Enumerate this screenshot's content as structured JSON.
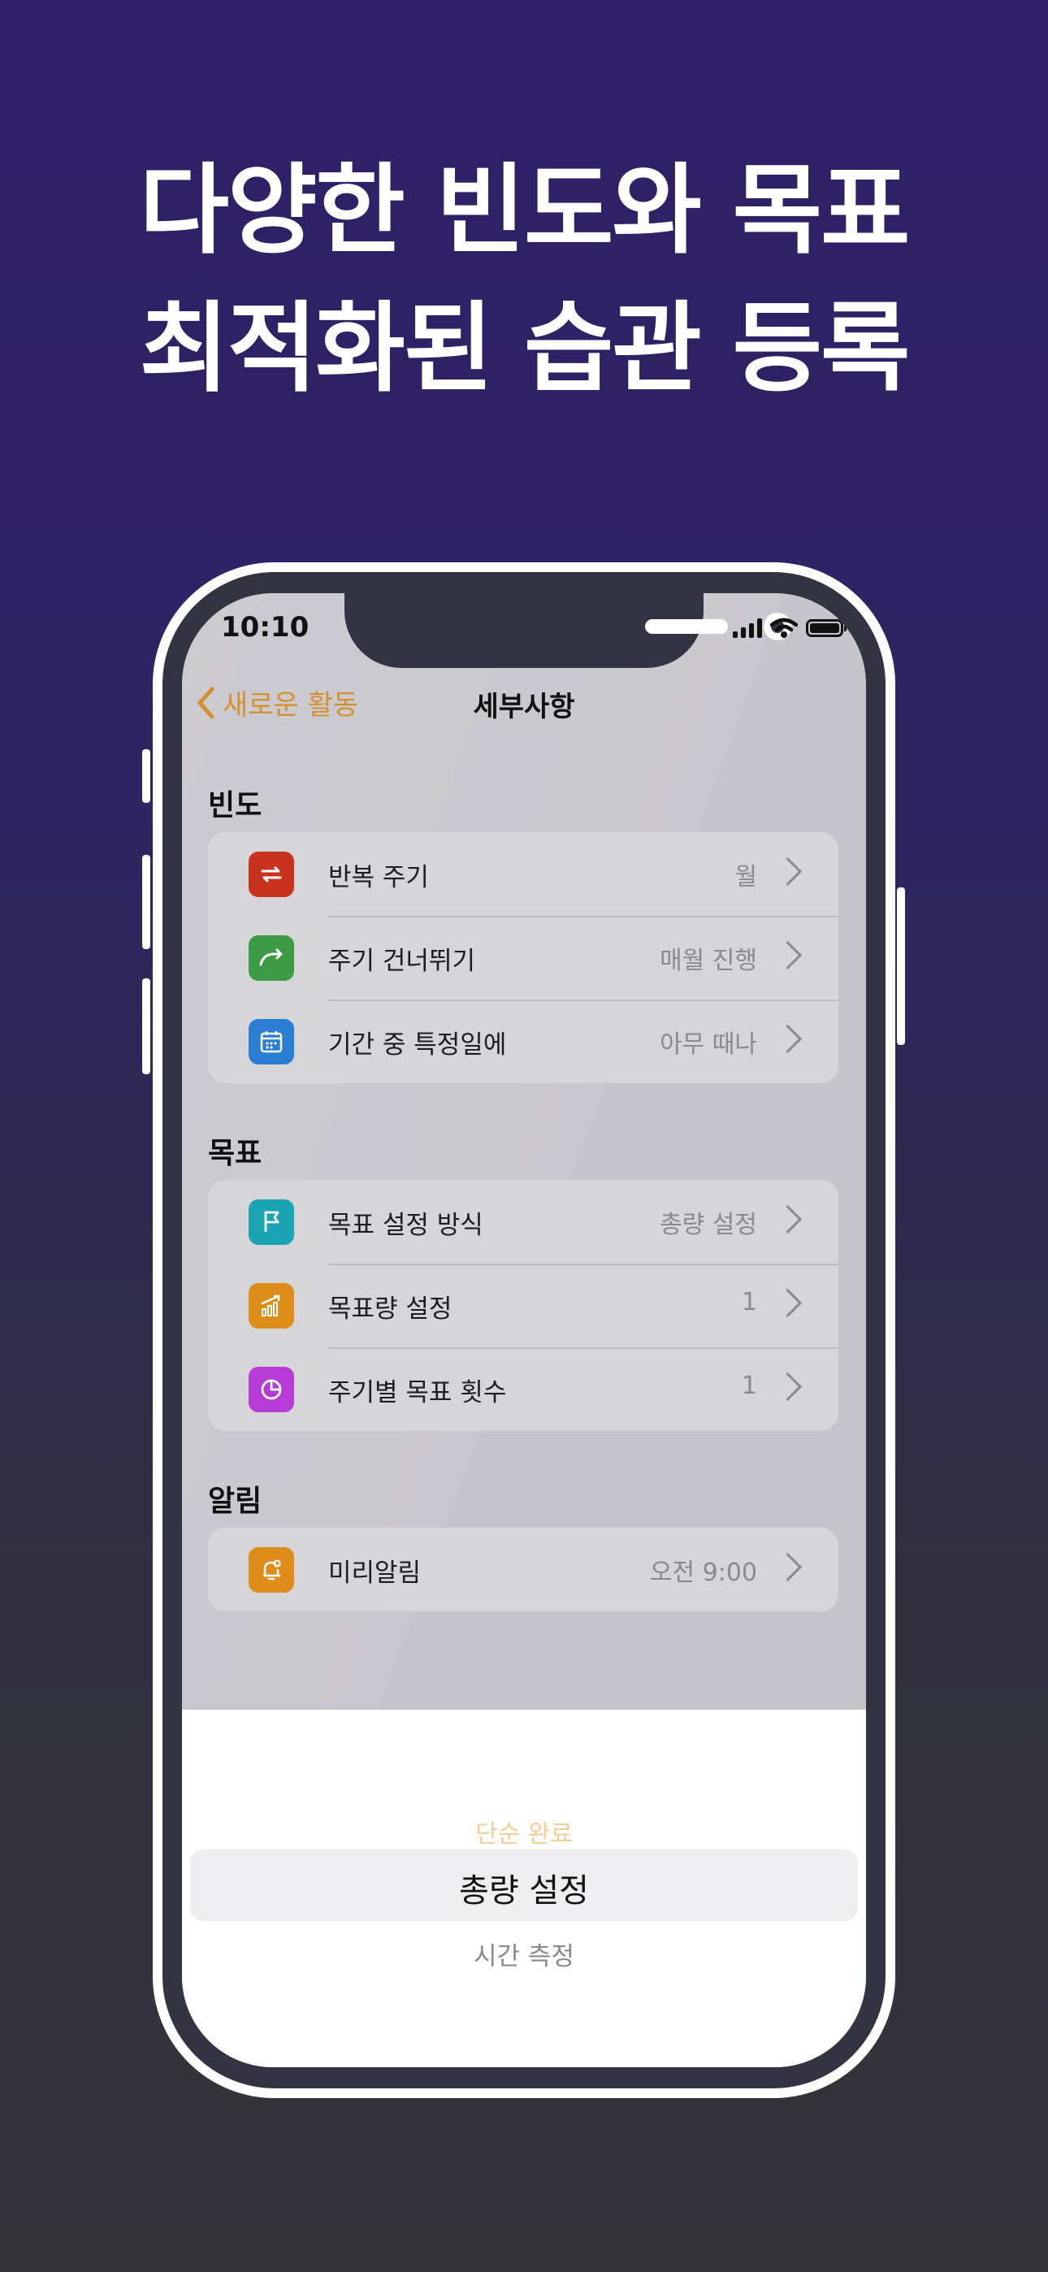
{
  "headline": {
    "line1": "다양한 빈도와 목표",
    "line2": "최적화된 습관 등록"
  },
  "status": {
    "time": "10:10"
  },
  "nav": {
    "back_label": "새로운 활동",
    "title": "세부사항"
  },
  "sections": [
    {
      "title": "빈도",
      "rows": [
        {
          "label": "반복 주기",
          "value": "월",
          "icon": "repeat-icon",
          "color": "#c9321f"
        },
        {
          "label": "주기 건너뛰기",
          "value": "매월 진행",
          "icon": "skip-arrow-icon",
          "color": "#3d9a45"
        },
        {
          "label": "기간 중 특정일에",
          "value": "아무 때나",
          "icon": "calendar-icon",
          "color": "#2a7fd4"
        }
      ]
    },
    {
      "title": "목표",
      "rows": [
        {
          "label": "목표 설정 방식",
          "value": "총량 설정",
          "icon": "flag-icon",
          "color": "#1aa3b3"
        },
        {
          "label": "목표량 설정",
          "value": "1",
          "icon": "chart-icon",
          "color": "#de8d1b"
        },
        {
          "label": "주기별 목표 횟수",
          "value": "1",
          "icon": "pie-icon",
          "color": "#b73bd6"
        }
      ]
    },
    {
      "title": "알림",
      "rows": [
        {
          "label": "미리알림",
          "value": "오전 9:00",
          "icon": "bell-icon",
          "color": "#de8d1b"
        }
      ]
    }
  ],
  "picker": {
    "above": "단순 완료",
    "selected": "총량 설정",
    "below": "시간 측정"
  },
  "colors": {
    "accent": "#d5902e",
    "background_top": "#2e2068",
    "background_bottom": "#353439"
  }
}
